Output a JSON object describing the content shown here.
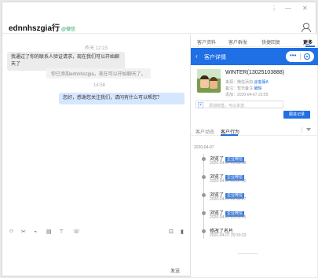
{
  "window": {
    "chat_title": "ednnhszgia",
    "chat_title_suffix": "行",
    "tag": "@微信",
    "win_buttons": [
      "⋮",
      "—",
      "✕"
    ]
  },
  "messages": [
    {
      "type": "time",
      "text": "昨天 12:23"
    },
    {
      "type": "in",
      "text": "我通过了你的联系人验证请求，现在我们可以开始聊天了"
    },
    {
      "type": "system",
      "text": "你已添加ednnhszgia，现在可以开始聊天了。"
    },
    {
      "type": "time",
      "text": "14:58"
    },
    {
      "type": "out",
      "text": "您好，感谢您关注我们，请问有什么可以帮您？"
    }
  ],
  "toolbar": {
    "icons": [
      "☺",
      "✂",
      "⌁",
      "▤",
      "⊤",
      "☏"
    ],
    "right_icons": [
      "⊡",
      "▮"
    ],
    "send_label": "发送"
  },
  "right_panel": {
    "tabs": [
      "客户资料",
      "客户群发",
      "快捷回复",
      "更多"
    ],
    "active_tab": 3,
    "header_title": "客户详情",
    "customer": {
      "name": "WINTER(13025103888)",
      "lines": [
        {
          "label": "来源：",
          "value": "微信添加",
          "link": "@客服A"
        },
        {
          "label": "备注：",
          "value": "暂无备注",
          "link": "编辑"
        },
        {
          "label": "添加：",
          "value": "2020-04-07 23:55",
          "link": ""
        }
      ],
      "tag": "+",
      "tag_hint": "添加标签，可以多选",
      "follow_button": "跟进记录"
    },
    "subtabs": [
      "客户动态",
      "客户行为"
    ],
    "active_subtab": 1,
    "timeline_date": "2020-04-07",
    "timeline": [
      {
        "title": "浏览了",
        "badge": "企业微信",
        "time": "2020-04-07 20:38:38"
      },
      {
        "title": "浏览了",
        "badge": "企业微信",
        "time": "2020-04-07 20:37:42"
      },
      {
        "title": "浏览了",
        "badge": "企业微信",
        "time": "2020-04-07 20:36:27"
      },
      {
        "title": "浏览了",
        "badge": "企业微信",
        "time": "2020-04-07 20:36:05"
      },
      {
        "title": "修改了名片",
        "badge": "",
        "time": "2020-04-07 20:33:23"
      }
    ],
    "more": "—————"
  },
  "colors": {
    "accent": "#1f6fe5",
    "out_bubble": "#d5e6ff",
    "in_bubble": "#ececec"
  }
}
